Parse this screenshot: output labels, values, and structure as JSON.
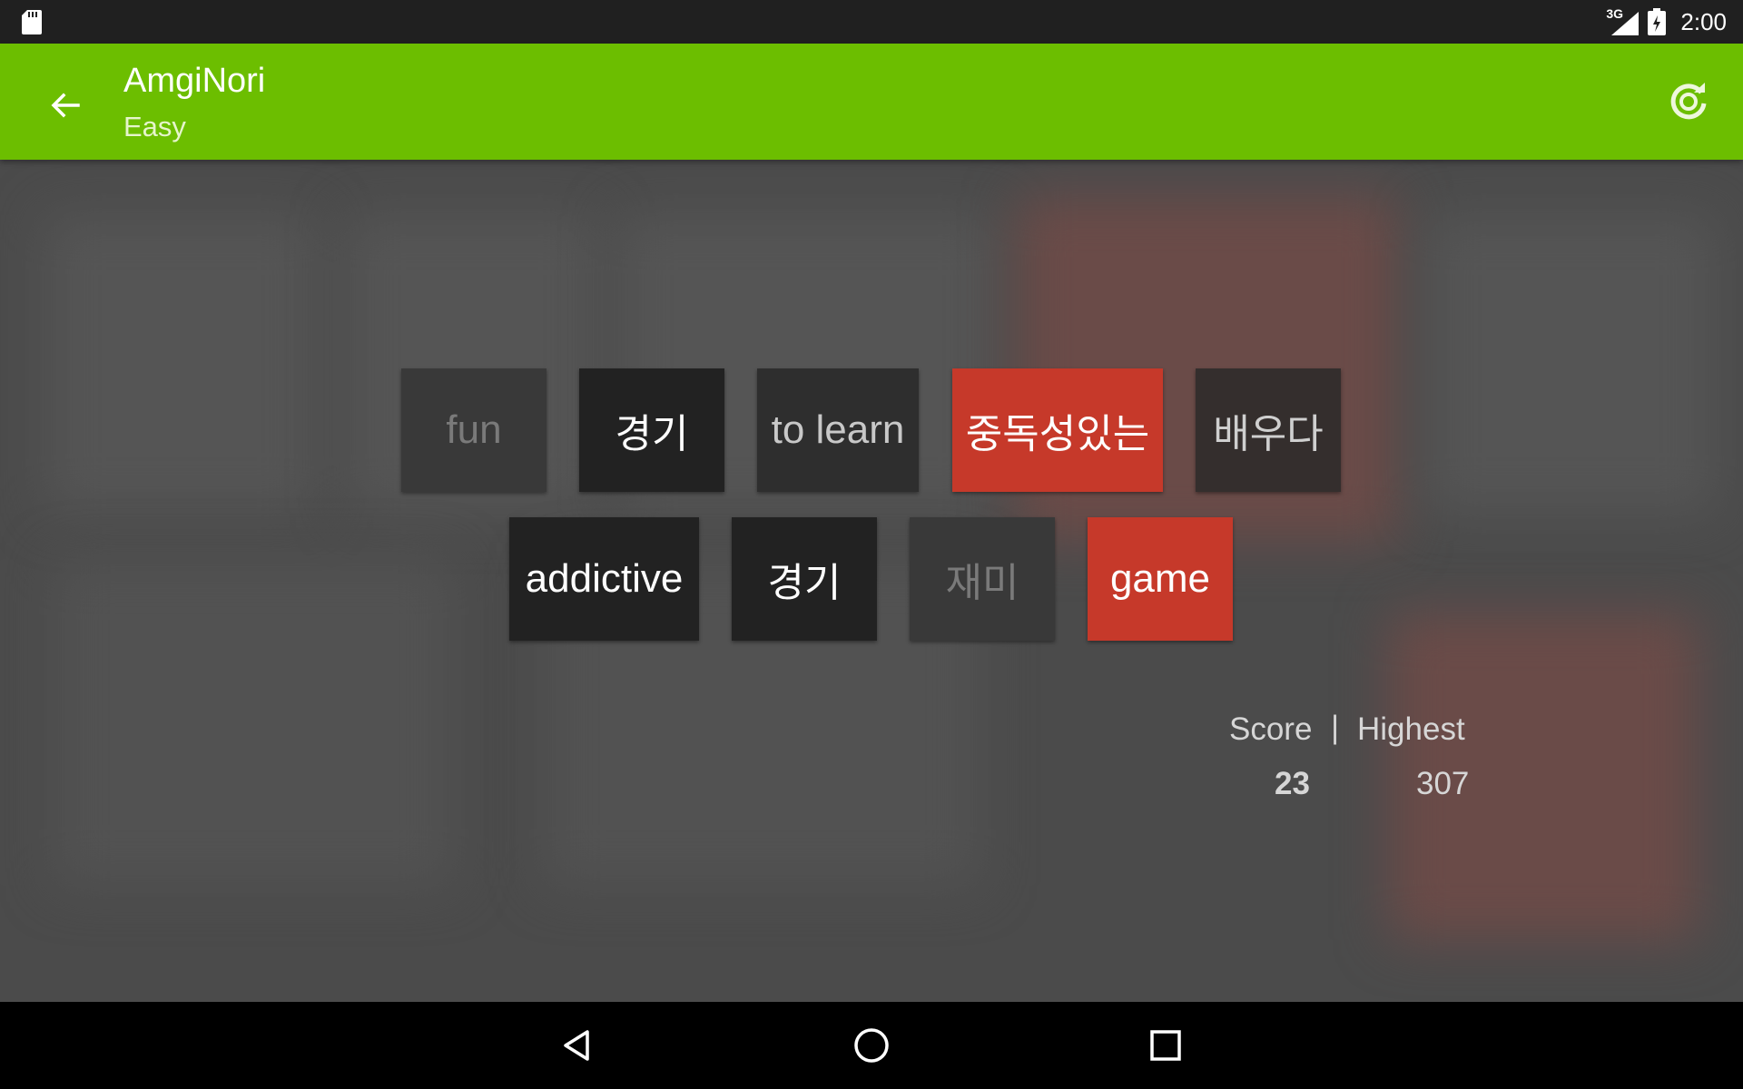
{
  "status_bar": {
    "left_icon": "sd-card-icon",
    "network_type": "3G",
    "signal_icon": "signal-icon",
    "battery_icon": "battery-charging-icon",
    "time": "2:00"
  },
  "app_bar": {
    "back_icon": "arrow-back-icon",
    "title": "AmgiNori",
    "subtitle": "Easy",
    "refresh_icon": "refresh-icon",
    "background_color": "#6cbe00"
  },
  "cards": {
    "row1": [
      {
        "label": "fun",
        "state": "dim"
      },
      {
        "label": "경기",
        "state": "dark"
      },
      {
        "label": "to learn",
        "state": "faded"
      },
      {
        "label": "중독성있는",
        "state": "selected"
      },
      {
        "label": "배우다",
        "state": "brown"
      }
    ],
    "row2": [
      {
        "label": "addictive",
        "state": "dark"
      },
      {
        "label": "경기",
        "state": "dark"
      },
      {
        "label": "재미",
        "state": "dim"
      },
      {
        "label": "game",
        "state": "selected"
      }
    ],
    "colors": {
      "selected": "#c6392a",
      "dark": "#222222"
    }
  },
  "score": {
    "score_label": "Score",
    "separator": "|",
    "highest_label": "Highest",
    "score_value": "23",
    "highest_value": "307"
  },
  "nav_bar": {
    "back_icon": "nav-back-icon",
    "home_icon": "nav-home-icon",
    "recents_icon": "nav-recents-icon"
  }
}
